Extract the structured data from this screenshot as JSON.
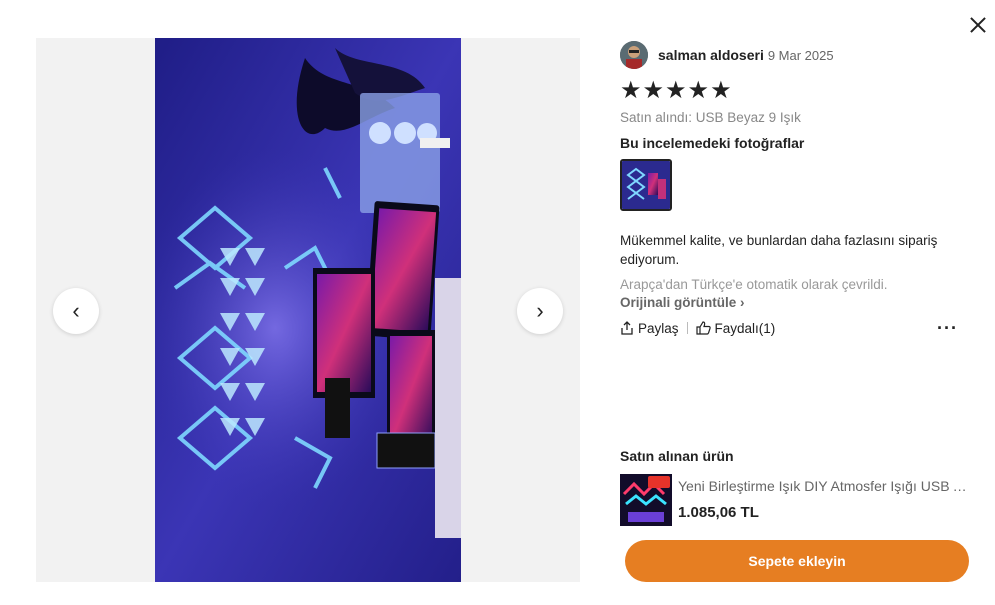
{
  "reviewer": {
    "name": "salman aldoseri",
    "date": "9 Mar 2025"
  },
  "rating": {
    "stars": "★★★★★",
    "value": 5
  },
  "purchased_variant": "Satın alındı: USB Beyaz 9 Işık",
  "photos_section_title": "Bu incelemedeki fotoğraflar",
  "review_text": "Mükemmel kalite, ve bunlardan daha fazlasını sipariş ediyorum.",
  "translation_note": "Arapça'dan Türkçe'e otomatik olarak çevrildi.",
  "view_original_label": "Orijinali görüntüle",
  "actions": {
    "share_label": "Paylaş",
    "helpful_label": "Faydalı(1)",
    "more_label": "···"
  },
  "nav": {
    "prev": "‹",
    "next": "›"
  },
  "product": {
    "section_title": "Satın alınan ürün",
    "name": "Yeni Birleştirme Işık DIY Atmosfer Işığı USB Arayüzü",
    "price": "1.085,06 TL"
  },
  "cart_button_label": "Sepete ekleyin",
  "colors": {
    "accent": "#e67e22",
    "photo_bg": "#2b2a8f"
  }
}
